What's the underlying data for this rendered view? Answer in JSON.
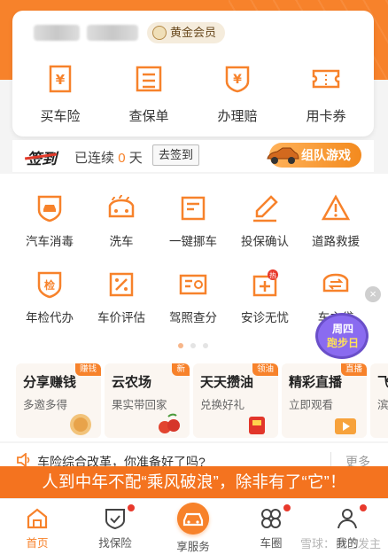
{
  "member": {
    "badge_label": "黄金会员",
    "quick_actions": [
      {
        "label": "买车险",
        "icon": "yuan-doc-icon"
      },
      {
        "label": "查保单",
        "icon": "policy-list-icon"
      },
      {
        "label": "办理赔",
        "icon": "yuan-shield-icon"
      },
      {
        "label": "用卡券",
        "icon": "ticket-icon"
      }
    ]
  },
  "signin": {
    "title": "签到",
    "streak_prefix": "已连续",
    "streak_days": "0",
    "streak_unit": "天",
    "button_label": "去签到",
    "team_game_label": "组队游戏"
  },
  "services": [
    {
      "label": "汽车消毒",
      "icon": "car-shield-icon"
    },
    {
      "label": "洗车",
      "icon": "car-wash-icon"
    },
    {
      "label": "一键挪车",
      "icon": "move-car-icon"
    },
    {
      "label": "投保确认",
      "icon": "pen-sign-icon"
    },
    {
      "label": "道路救援",
      "icon": "warning-triangle-icon"
    },
    {
      "label": "年检代办",
      "icon": "inspection-shield-icon"
    },
    {
      "label": "车价评估",
      "icon": "percent-icon"
    },
    {
      "label": "驾照查分",
      "icon": "license-card-icon"
    },
    {
      "label": "安诊无忧",
      "icon": "medical-plus-icon",
      "badge": "热"
    },
    {
      "label": "车主贷",
      "icon": "loan-car-icon"
    }
  ],
  "week_badge": {
    "line1": "周四",
    "line2": "跑步日"
  },
  "features": [
    {
      "title": "分享赚钱",
      "subtitle": "多邀多得",
      "tag": "赚钱"
    },
    {
      "title": "云农场",
      "subtitle": "果实带回家",
      "tag": "新"
    },
    {
      "title": "天天攒油",
      "subtitle": "兑换好礼",
      "tag": "领油"
    },
    {
      "title": "精彩直播",
      "subtitle": "立即观看",
      "tag": "直播"
    },
    {
      "title": "飞",
      "subtitle": "滨",
      "tag": ""
    }
  ],
  "notice": {
    "text": "车险综合改革，你准备好了吗?",
    "more": "更多"
  },
  "banner": {
    "text": "人到中年不配“乘风破浪”，除非有了“它”！"
  },
  "tabbar": [
    {
      "label": "首页",
      "icon": "home-icon",
      "active": true,
      "dot": false
    },
    {
      "label": "找保险",
      "icon": "shield-check-icon",
      "active": false,
      "dot": true
    },
    {
      "label": "享服务",
      "icon": "car-circle-icon",
      "active": false,
      "dot": false
    },
    {
      "label": "车圈",
      "icon": "grid-circles-icon",
      "active": false,
      "dot": true
    },
    {
      "label": "我的",
      "icon": "profile-icon",
      "active": false,
      "dot": true
    }
  ],
  "watermark": "雪球：自己发主",
  "colors": {
    "accent": "#f7822b",
    "red_dot": "#e8392c",
    "banner": "#f4731f"
  }
}
